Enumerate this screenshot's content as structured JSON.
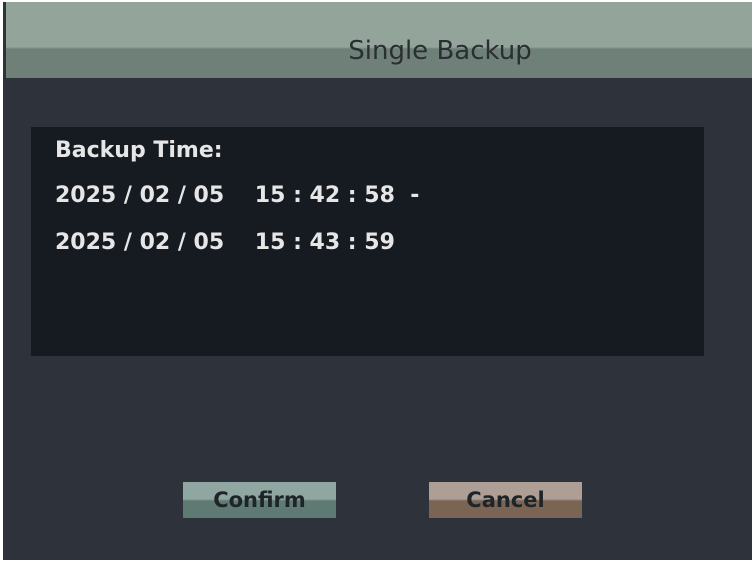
{
  "dialog": {
    "title": "Single Backup"
  },
  "backup_info": {
    "label": "Backup Time:",
    "start": "2025 / 02 / 05    15 : 42 : 58  -",
    "end": "2025 / 02 / 05    15 : 43 : 59"
  },
  "buttons": {
    "confirm_label": "Confirm",
    "cancel_label": "Cancel"
  },
  "colors": {
    "background": "#2e333b",
    "titlebar": "#93a49b",
    "panel": "#161a21",
    "confirm": "#8fa7a0",
    "cancel": "#ad9f96"
  }
}
